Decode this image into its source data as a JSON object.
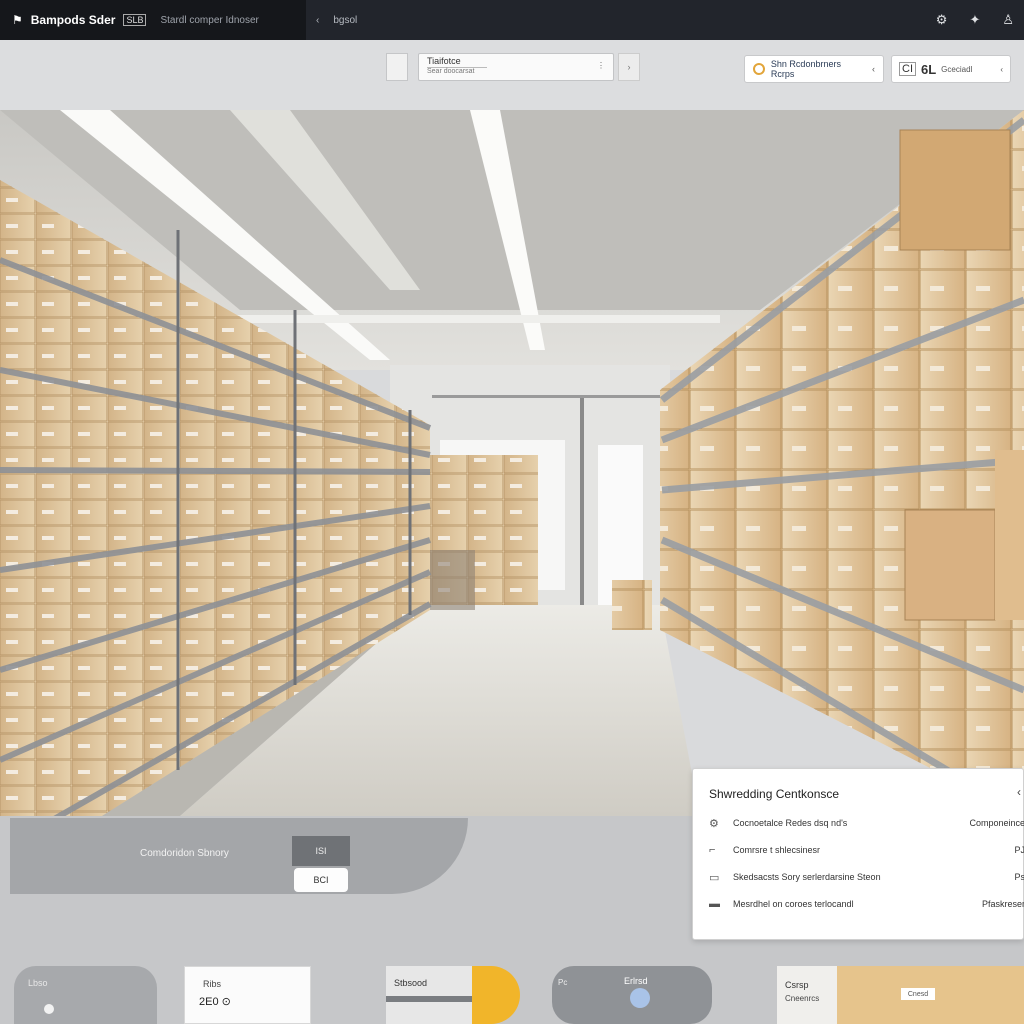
{
  "header": {
    "app_name": "Bampods Sder",
    "tag": "SLB",
    "subtitle": "Stardl comper Idnoser",
    "nav_arrow": "‹",
    "breadcrumb": "bgsol"
  },
  "toolbar": {
    "filter": {
      "label": "Tiaifotce",
      "sublabel": "Sear doocarsat",
      "handle": "⋮"
    },
    "store_select": {
      "label": "Shn Rcdonbrners Rcrps",
      "chevron": "‹"
    },
    "view_select": {
      "icon_text": "CI",
      "code": "6L",
      "label": "Gceciadl",
      "chevron": "‹"
    }
  },
  "category": {
    "label": "Comdoridon Sbnory",
    "chip_top": "ISI",
    "chip_button": "BCI"
  },
  "panel": {
    "title": "Shwredding Centkonsce",
    "close": "‹",
    "rows": [
      {
        "icon": "gear-people-icon",
        "label": "Cocnoetalce Redes dsq nd's",
        "value": "Componeince"
      },
      {
        "icon": "cart-icon",
        "label": "Comrsre t shlecsinesr",
        "value": "PJ"
      },
      {
        "icon": "card-icon",
        "label": "Skedsacsts Sory serlerdarsine Steon",
        "value": "Ps"
      },
      {
        "icon": "box-icon",
        "label": "Mesrdhel on coroes terlocandl",
        "value": "Pfaskreser"
      }
    ]
  },
  "cards": [
    {
      "title": "Lbso"
    },
    {
      "title": "Ribs",
      "value": "2E0 ⊙"
    },
    {
      "title": "Stbsood"
    },
    {
      "title1": "Pc",
      "title2": "Erlrsd"
    },
    {
      "title1": "Csrsp",
      "title2": "Cneenrcs",
      "pill": "Cnesd"
    }
  ],
  "colors": {
    "topbar": "#22252c",
    "accent_yellow": "#f1b52a",
    "cardboard": "#d9b98a"
  }
}
